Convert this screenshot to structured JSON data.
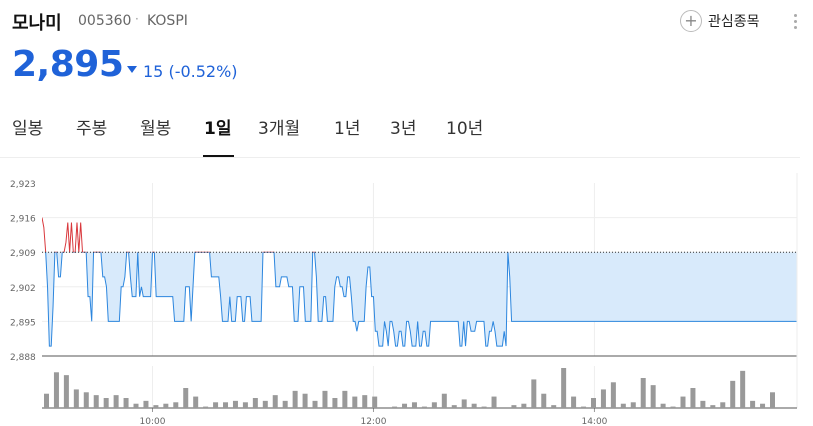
{
  "header": {
    "name": "모나미",
    "code": "005360",
    "separator": "·",
    "market": "KOSPI",
    "price": "2,895",
    "change": "15 (-0.52%)",
    "favorite_label": "관심종목"
  },
  "colors": {
    "down": "#1f62d8",
    "up": "#d9383c",
    "fill": "#d8eafb",
    "line": "#2c86de",
    "volume": "#999999"
  },
  "tabs": [
    {
      "label": "일봉",
      "active": false
    },
    {
      "label": "주봉",
      "active": false
    },
    {
      "label": "월봉",
      "active": false
    },
    {
      "label": "1일",
      "active": true
    },
    {
      "label": "3개월",
      "active": false
    },
    {
      "label": "1년",
      "active": false
    },
    {
      "label": "3년",
      "active": false
    },
    {
      "label": "10년",
      "active": false
    }
  ],
  "chart_data": {
    "type": "line",
    "y_ticks": [
      "2,923",
      "2,916",
      "2,909",
      "2,902",
      "2,895",
      "2,888"
    ],
    "x_ticks": [
      "10:00",
      "12:00",
      "14:00"
    ],
    "ylim": [
      2888,
      2923
    ],
    "reference": 2909,
    "grid": true,
    "x_range_minutes": [
      540,
      950
    ],
    "series": [
      {
        "points": [
          [
            540,
            2916
          ],
          [
            541,
            2914
          ],
          [
            542,
            2909
          ],
          [
            543,
            2902
          ],
          [
            544,
            2890
          ],
          [
            545,
            2890
          ],
          [
            546,
            2898
          ],
          [
            547,
            2909
          ],
          [
            548,
            2909
          ],
          [
            549,
            2904
          ],
          [
            550,
            2904
          ],
          [
            551,
            2909
          ],
          [
            552,
            2909
          ],
          [
            553,
            2911
          ],
          [
            554,
            2915
          ],
          [
            555,
            2909
          ],
          [
            556,
            2915
          ],
          [
            557,
            2909
          ],
          [
            558,
            2909
          ],
          [
            559,
            2915
          ],
          [
            560,
            2909
          ],
          [
            561,
            2915
          ],
          [
            562,
            2909
          ],
          [
            563,
            2909
          ],
          [
            564,
            2909
          ],
          [
            565,
            2900
          ],
          [
            566,
            2900
          ],
          [
            567,
            2895
          ],
          [
            568,
            2909
          ],
          [
            569,
            2909
          ],
          [
            570,
            2909
          ],
          [
            571,
            2909
          ],
          [
            572,
            2909
          ],
          [
            573,
            2904
          ],
          [
            574,
            2904
          ],
          [
            575,
            2902
          ],
          [
            576,
            2895
          ],
          [
            577,
            2895
          ],
          [
            578,
            2895
          ],
          [
            579,
            2895
          ],
          [
            580,
            2895
          ],
          [
            581,
            2895
          ],
          [
            582,
            2895
          ],
          [
            583,
            2902
          ],
          [
            584,
            2902
          ],
          [
            585,
            2904
          ],
          [
            586,
            2909
          ],
          [
            587,
            2909
          ],
          [
            588,
            2904
          ],
          [
            589,
            2900
          ],
          [
            590,
            2900
          ],
          [
            591,
            2900
          ],
          [
            592,
            2909
          ],
          [
            593,
            2900
          ],
          [
            594,
            2902
          ],
          [
            595,
            2900
          ],
          [
            596,
            2900
          ],
          [
            597,
            2900
          ],
          [
            598,
            2900
          ],
          [
            599,
            2900
          ],
          [
            600,
            2909
          ],
          [
            601,
            2909
          ],
          [
            602,
            2900
          ],
          [
            603,
            2900
          ],
          [
            604,
            2900
          ],
          [
            605,
            2900
          ],
          [
            606,
            2900
          ],
          [
            607,
            2900
          ],
          [
            608,
            2900
          ],
          [
            609,
            2900
          ],
          [
            610,
            2900
          ],
          [
            611,
            2900
          ],
          [
            612,
            2895
          ],
          [
            613,
            2895
          ],
          [
            614,
            2895
          ],
          [
            615,
            2895
          ],
          [
            616,
            2895
          ],
          [
            617,
            2895
          ],
          [
            618,
            2902
          ],
          [
            619,
            2902
          ],
          [
            620,
            2902
          ],
          [
            621,
            2895
          ],
          [
            622,
            2902
          ],
          [
            623,
            2909
          ],
          [
            624,
            2909
          ],
          [
            625,
            2909
          ],
          [
            626,
            2909
          ],
          [
            627,
            2909
          ],
          [
            628,
            2909
          ],
          [
            629,
            2909
          ],
          [
            630,
            2909
          ],
          [
            631,
            2909
          ],
          [
            632,
            2904
          ],
          [
            633,
            2904
          ],
          [
            634,
            2904
          ],
          [
            635,
            2904
          ],
          [
            636,
            2904
          ],
          [
            637,
            2900
          ],
          [
            638,
            2895
          ],
          [
            639,
            2895
          ],
          [
            640,
            2895
          ],
          [
            641,
            2895
          ],
          [
            642,
            2900
          ],
          [
            643,
            2895
          ],
          [
            644,
            2895
          ],
          [
            645,
            2895
          ],
          [
            646,
            2900
          ],
          [
            647,
            2900
          ],
          [
            648,
            2900
          ],
          [
            649,
            2895
          ],
          [
            650,
            2895
          ],
          [
            651,
            2900
          ],
          [
            652,
            2900
          ],
          [
            653,
            2900
          ],
          [
            654,
            2895
          ],
          [
            655,
            2895
          ],
          [
            656,
            2895
          ],
          [
            657,
            2895
          ],
          [
            658,
            2895
          ],
          [
            659,
            2895
          ],
          [
            660,
            2909
          ],
          [
            661,
            2909
          ],
          [
            662,
            2909
          ],
          [
            663,
            2909
          ],
          [
            664,
            2909
          ],
          [
            665,
            2909
          ],
          [
            666,
            2909
          ],
          [
            667,
            2902
          ],
          [
            668,
            2902
          ],
          [
            669,
            2902
          ],
          [
            670,
            2904
          ],
          [
            671,
            2904
          ],
          [
            672,
            2904
          ],
          [
            673,
            2904
          ],
          [
            674,
            2902
          ],
          [
            675,
            2902
          ],
          [
            676,
            2902
          ],
          [
            677,
            2895
          ],
          [
            678,
            2895
          ],
          [
            679,
            2895
          ],
          [
            680,
            2902
          ],
          [
            681,
            2902
          ],
          [
            682,
            2902
          ],
          [
            683,
            2895
          ],
          [
            684,
            2895
          ],
          [
            685,
            2895
          ],
          [
            686,
            2895
          ],
          [
            687,
            2909
          ],
          [
            688,
            2909
          ],
          [
            689,
            2904
          ],
          [
            690,
            2895
          ],
          [
            691,
            2895
          ],
          [
            692,
            2895
          ],
          [
            693,
            2900
          ],
          [
            694,
            2900
          ],
          [
            695,
            2895
          ],
          [
            696,
            2895
          ],
          [
            697,
            2895
          ],
          [
            698,
            2895
          ],
          [
            699,
            2902
          ],
          [
            700,
            2904
          ],
          [
            701,
            2904
          ],
          [
            702,
            2902
          ],
          [
            703,
            2902
          ],
          [
            704,
            2900
          ],
          [
            705,
            2900
          ],
          [
            706,
            2904
          ],
          [
            707,
            2904
          ],
          [
            708,
            2900
          ],
          [
            709,
            2895
          ],
          [
            710,
            2895
          ],
          [
            711,
            2893
          ],
          [
            712,
            2895
          ],
          [
            713,
            2895
          ],
          [
            714,
            2895
          ],
          [
            715,
            2895
          ],
          [
            716,
            2902
          ],
          [
            717,
            2906
          ],
          [
            718,
            2906
          ],
          [
            719,
            2900
          ],
          [
            720,
            2900
          ],
          [
            721,
            2893
          ],
          [
            722,
            2893
          ],
          [
            723,
            2890
          ],
          [
            724,
            2890
          ],
          [
            725,
            2890
          ],
          [
            726,
            2895
          ],
          [
            727,
            2893
          ],
          [
            728,
            2890
          ],
          [
            729,
            2895
          ],
          [
            730,
            2895
          ],
          [
            731,
            2893
          ],
          [
            732,
            2890
          ],
          [
            733,
            2890
          ],
          [
            734,
            2893
          ],
          [
            735,
            2893
          ],
          [
            736,
            2890
          ],
          [
            737,
            2890
          ],
          [
            738,
            2895
          ],
          [
            739,
            2895
          ],
          [
            740,
            2893
          ],
          [
            741,
            2890
          ],
          [
            742,
            2890
          ],
          [
            743,
            2890
          ],
          [
            744,
            2895
          ],
          [
            745,
            2890
          ],
          [
            746,
            2890
          ],
          [
            747,
            2893
          ],
          [
            748,
            2893
          ],
          [
            749,
            2890
          ],
          [
            750,
            2890
          ],
          [
            751,
            2895
          ],
          [
            752,
            2895
          ],
          [
            753,
            2895
          ],
          [
            754,
            2895
          ],
          [
            755,
            2895
          ],
          [
            756,
            2895
          ],
          [
            757,
            2895
          ],
          [
            758,
            2895
          ],
          [
            759,
            2895
          ],
          [
            760,
            2895
          ],
          [
            761,
            2895
          ],
          [
            762,
            2895
          ],
          [
            763,
            2895
          ],
          [
            764,
            2895
          ],
          [
            765,
            2895
          ],
          [
            766,
            2895
          ],
          [
            767,
            2890
          ],
          [
            768,
            2890
          ],
          [
            769,
            2895
          ],
          [
            770,
            2890
          ],
          [
            771,
            2895
          ],
          [
            772,
            2895
          ],
          [
            773,
            2893
          ],
          [
            774,
            2893
          ],
          [
            775,
            2893
          ],
          [
            776,
            2895
          ],
          [
            777,
            2895
          ],
          [
            778,
            2895
          ],
          [
            779,
            2895
          ],
          [
            780,
            2895
          ],
          [
            781,
            2890
          ],
          [
            782,
            2890
          ],
          [
            783,
            2893
          ],
          [
            784,
            2893
          ],
          [
            785,
            2895
          ],
          [
            786,
            2893
          ],
          [
            787,
            2890
          ],
          [
            788,
            2890
          ],
          [
            789,
            2890
          ],
          [
            790,
            2890
          ],
          [
            791,
            2893
          ],
          [
            792,
            2890
          ],
          [
            793,
            2909
          ],
          [
            794,
            2904
          ],
          [
            795,
            2895
          ],
          [
            796,
            2895
          ],
          [
            797,
            2895
          ],
          [
            798,
            2895
          ],
          [
            799,
            2895
          ],
          [
            800,
            2895
          ],
          [
            801,
            2895
          ],
          [
            802,
            2895
          ],
          [
            803,
            2895
          ],
          [
            804,
            2895
          ],
          [
            805,
            2895
          ],
          [
            806,
            2895
          ],
          [
            807,
            2895
          ],
          [
            808,
            2895
          ],
          [
            809,
            2895
          ],
          [
            810,
            2895
          ],
          [
            811,
            2895
          ],
          [
            812,
            2895
          ],
          [
            813,
            2895
          ],
          [
            814,
            2895
          ]
        ]
      }
    ],
    "volume": [
      10,
      25,
      23,
      13,
      11,
      9,
      7,
      9,
      7,
      3,
      5,
      2,
      3,
      4,
      14,
      8,
      1,
      4,
      4,
      5,
      4,
      7,
      5,
      9,
      5,
      12,
      10,
      5,
      12,
      7,
      12,
      8,
      9,
      8,
      0,
      1,
      3,
      4,
      1,
      4,
      10,
      2,
      6,
      3,
      1,
      8,
      0,
      2,
      3,
      20,
      10,
      2,
      28,
      8,
      1,
      7,
      13,
      18,
      3,
      4,
      21,
      16,
      3,
      1,
      8,
      14,
      5,
      2,
      4,
      19,
      26,
      5,
      3,
      11
    ]
  }
}
